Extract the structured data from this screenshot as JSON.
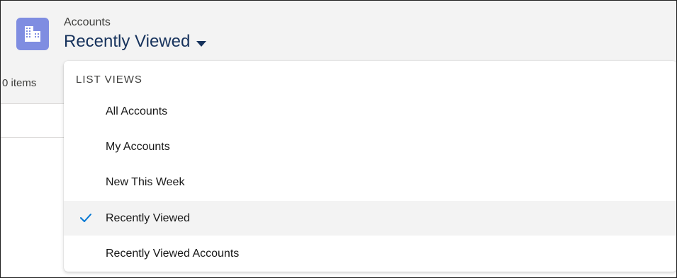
{
  "header": {
    "object_label": "Accounts",
    "list_view_title": "Recently Viewed",
    "item_count": "0 items",
    "icon": "accounts-building-icon",
    "icon_color": "#7f8de1",
    "title_color": "#16325c"
  },
  "dropdown": {
    "heading": "LIST VIEWS",
    "items": [
      {
        "label": "All Accounts",
        "selected": false
      },
      {
        "label": "My Accounts",
        "selected": false
      },
      {
        "label": "New This Week",
        "selected": false
      },
      {
        "label": "Recently Viewed",
        "selected": true
      },
      {
        "label": "Recently Viewed Accounts",
        "selected": false
      }
    ],
    "selected_check_icon": "check-icon",
    "accent_color": "#0176d3"
  }
}
